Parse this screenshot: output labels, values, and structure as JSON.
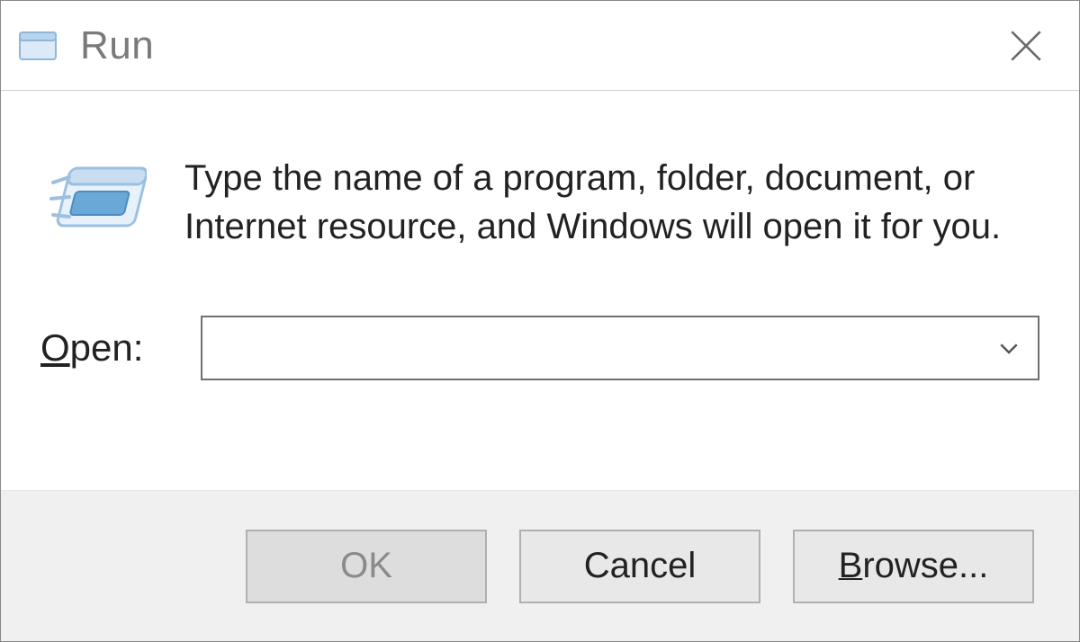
{
  "window": {
    "title": "Run"
  },
  "body": {
    "description": "Type the name of a program, folder, document, or Internet resource, and Windows will open it for you.",
    "open_label_prefix": "O",
    "open_label_rest": "pen:",
    "open_value": ""
  },
  "buttons": {
    "ok": "OK",
    "cancel": "Cancel",
    "browse_prefix": "B",
    "browse_rest": "rowse..."
  }
}
